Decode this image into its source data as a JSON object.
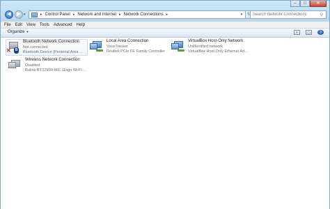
{
  "address": {
    "crumbs": [
      "Control Panel",
      "Network and Internet",
      "Network Connections"
    ]
  },
  "search": {
    "placeholder": "Search Network Connections"
  },
  "menu": [
    "File",
    "Edit",
    "View",
    "Tools",
    "Advanced",
    "Help"
  ],
  "toolbar": {
    "organize_label": "Organize"
  },
  "icons": {
    "back": "back-arrow-icon",
    "forward": "forward-arrow-icon",
    "refresh": "refresh-icon",
    "search": "search-icon",
    "views": "change-view-icon",
    "preview": "preview-pane-icon",
    "help": "help-icon"
  },
  "connections": [
    {
      "name": "Bluetooth Network Connection",
      "status": "Not connected",
      "device": "Bluetooth Device (Personal Area ...",
      "selected": true
    },
    {
      "name": "Local Area Connection",
      "status": "VirusTracker",
      "device": "Realtek PCIe FE Family Controller"
    },
    {
      "name": "VirtualBox Host-Only Network",
      "status": "Unidentified network",
      "device": "VirtualBox Host-Only Ethernet Ad..."
    },
    {
      "name": "Wireless Network Connection",
      "status": "Disabled",
      "device": "Ralink RT3290R 802.11bgn Wi-Fi ..."
    }
  ],
  "colors": {
    "accent": "#3f7fc4",
    "selection": "#c9dbef",
    "disconnected": "#d0231b"
  }
}
